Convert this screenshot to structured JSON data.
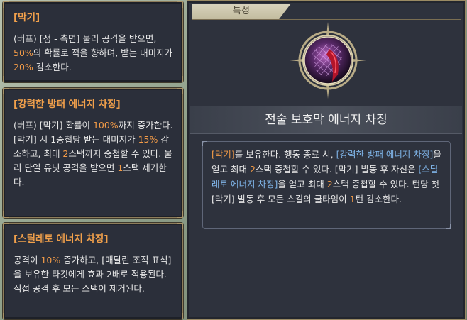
{
  "cards": [
    {
      "header": "[막기]",
      "segments": [
        {
          "t": "(버프) [정 - 측면] 물리 공격을 받으면, "
        },
        {
          "t": "50%",
          "c": "hl"
        },
        {
          "t": "의 확률로 적을 향하며, 받는 대미지가 "
        },
        {
          "t": "20%",
          "c": "hl"
        },
        {
          "t": " 감소한다."
        }
      ]
    },
    {
      "header": "[강력한 방패 에너지 차징]",
      "segments": [
        {
          "t": "(버프) [막기] 확률이 "
        },
        {
          "t": "100%",
          "c": "hl"
        },
        {
          "t": "까지 증가한다. [막기] 시 1중첩당 받는 대미지가 "
        },
        {
          "t": "15%",
          "c": "hl"
        },
        {
          "t": " 감소하고, 최대 "
        },
        {
          "t": "2",
          "c": "hl"
        },
        {
          "t": "스택까지 중첩할 수 있다. 물리 단일 유닛 공격을 받으면 "
        },
        {
          "t": "1",
          "c": "hl"
        },
        {
          "t": "스택 제거한다."
        }
      ]
    },
    {
      "header": "[스틸레토 에너지 차징]",
      "segments": [
        {
          "t": "공격이 "
        },
        {
          "t": "10%",
          "c": "hl"
        },
        {
          "t": " 증가하고, [매달린 조직 표식]을 보유한 타깃에게 효과 2배로 적용된다. 직접 공격 후 모든 스택이 제거된다."
        }
      ]
    }
  ],
  "panel": {
    "tab_label": "특성",
    "icon": "shield-energy-emblem-icon",
    "title": "전술 보호막 에너지 차징",
    "description": [
      {
        "t": "[막기]",
        "c": "hl"
      },
      {
        "t": "를 보유한다. 행동 종료 시, "
      },
      {
        "t": "[강력한 방패 에너지 차징]",
        "c": "bl"
      },
      {
        "t": "을 얻고 최대 "
      },
      {
        "t": "2",
        "c": "hl"
      },
      {
        "t": "스택 중첩할 수 있다. [막기] 발동 후 자신은 "
      },
      {
        "t": "[스틸레토 에너지 차징]",
        "c": "bl"
      },
      {
        "t": "을 얻고 최대 "
      },
      {
        "t": "2",
        "c": "hl"
      },
      {
        "t": "스택 중첩할 수 있다. 턴당 첫 [막기] 발동 후 모든 스킬의 쿨타임이 "
      },
      {
        "t": "1",
        "c": "hl"
      },
      {
        "t": "턴 감소한다."
      }
    ]
  },
  "colors": {
    "highlight": "#f39b47",
    "link_blue": "#7fb4e8",
    "panel_bg": "#2e323d",
    "border_gold": "#9a8a63"
  }
}
